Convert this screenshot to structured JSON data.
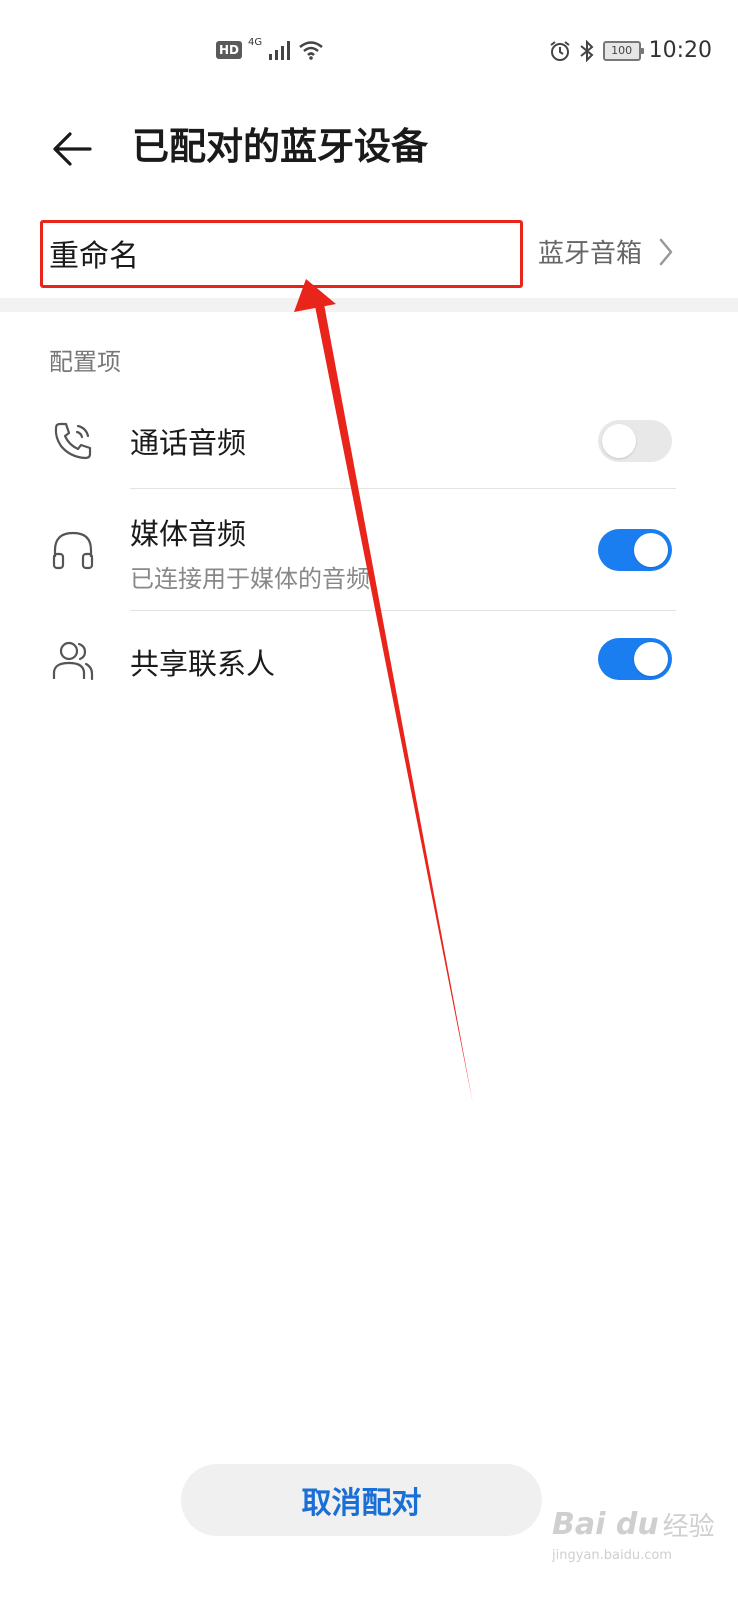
{
  "status_bar": {
    "hd_label": "HD",
    "network_label": "4G",
    "battery_level": "100",
    "time": "10:20"
  },
  "header": {
    "title": "已配对的蓝牙设备"
  },
  "rename": {
    "label": "重命名",
    "value": "蓝牙音箱"
  },
  "section": {
    "title": "配置项"
  },
  "options": [
    {
      "label": "通话音频",
      "subtitle": "",
      "enabled": false,
      "icon": "phone-call-icon"
    },
    {
      "label": "媒体音频",
      "subtitle": "已连接用于媒体的音频",
      "enabled": true,
      "icon": "headphones-icon"
    },
    {
      "label": "共享联系人",
      "subtitle": "",
      "enabled": true,
      "icon": "contacts-icon"
    }
  ],
  "unpair_button": {
    "label": "取消配对"
  },
  "watermark": {
    "logo": "Bai du",
    "text": "经验",
    "url": "jingyan.baidu.com"
  },
  "colors": {
    "accent": "#1a7ef0",
    "toggle_off": "#e8e8e8",
    "annotation_red": "#e8241b",
    "button_text": "#1a6fd6"
  }
}
